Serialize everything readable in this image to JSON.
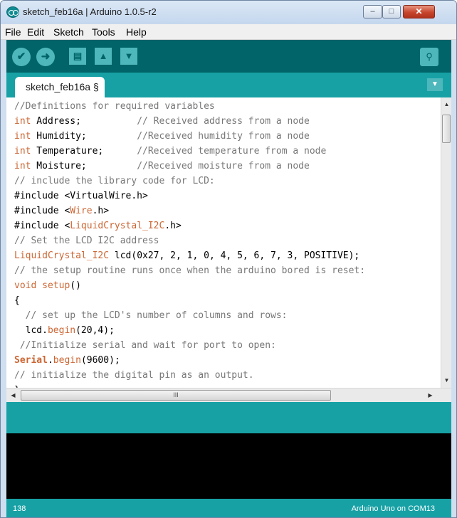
{
  "window": {
    "title": "sketch_feb16a | Arduino 1.0.5-r2",
    "app_icon": "arduino-logo-icon",
    "controls": {
      "minimize": "–",
      "maximize": "□",
      "close": "✕"
    }
  },
  "menu": [
    "File",
    "Edit",
    "Sketch",
    "Tools",
    "Help"
  ],
  "toolbar": {
    "buttons": [
      {
        "name": "verify",
        "icon": "checkmark-icon",
        "glyph": "✔"
      },
      {
        "name": "upload",
        "icon": "right-arrow-icon",
        "glyph": "➜"
      },
      {
        "name": "new",
        "icon": "new-file-icon",
        "glyph": "▤"
      },
      {
        "name": "open",
        "icon": "up-arrow-icon",
        "glyph": "▲"
      },
      {
        "name": "save",
        "icon": "down-arrow-icon",
        "glyph": "▼"
      }
    ],
    "serial_monitor": {
      "icon": "magnifier-icon",
      "glyph": "⚲"
    },
    "colors": {
      "bar": "#006468",
      "button": "#4db7bb"
    }
  },
  "tabs": {
    "active": "sketch_feb16a §",
    "menu_glyph": "▼"
  },
  "editor": {
    "lines": [
      [
        {
          "t": "//Definitions for required variables",
          "c": "cm"
        }
      ],
      [
        {
          "t": "int",
          "c": "kw"
        },
        {
          "t": " Address;          ",
          "c": ""
        },
        {
          "t": "// Received address from a node",
          "c": "cm"
        }
      ],
      [
        {
          "t": "int",
          "c": "kw"
        },
        {
          "t": " Humidity;         ",
          "c": ""
        },
        {
          "t": "//Received humidity from a node",
          "c": "cm"
        }
      ],
      [
        {
          "t": "int",
          "c": "kw"
        },
        {
          "t": " Temperature;      ",
          "c": ""
        },
        {
          "t": "//Received temperature from a node",
          "c": "cm"
        }
      ],
      [
        {
          "t": "int",
          "c": "kw"
        },
        {
          "t": " Moisture;         ",
          "c": ""
        },
        {
          "t": "//Received moisture from a node",
          "c": "cm"
        }
      ],
      [
        {
          "t": "// include the library code for LCD:",
          "c": "cm"
        }
      ],
      [
        {
          "t": "#include <VirtualWire.h>",
          "c": ""
        }
      ],
      [
        {
          "t": "#include <",
          "c": ""
        },
        {
          "t": "Wire",
          "c": "lib"
        },
        {
          "t": ".h>",
          "c": ""
        }
      ],
      [
        {
          "t": "#include <",
          "c": ""
        },
        {
          "t": "LiquidCrystal_I2C",
          "c": "lib"
        },
        {
          "t": ".h>",
          "c": ""
        }
      ],
      [
        {
          "t": "// Set the LCD I2C address",
          "c": "cm"
        }
      ],
      [
        {
          "t": "LiquidCrystal_I2C",
          "c": "lib"
        },
        {
          "t": " lcd(0x27, 2, 1, 0, 4, 5, 6, 7, 3, POSITIVE);",
          "c": ""
        }
      ],
      [
        {
          "t": "// the setup routine runs once when the arduino bored is reset:",
          "c": "cm"
        }
      ],
      [
        {
          "t": "void",
          "c": "kw"
        },
        {
          "t": " ",
          "c": ""
        },
        {
          "t": "setup",
          "c": "fn"
        },
        {
          "t": "()",
          "c": ""
        }
      ],
      [
        {
          "t": "{",
          "c": ""
        }
      ],
      [
        {
          "t": "  // set up the LCD's number of columns and rows:",
          "c": "cm"
        }
      ],
      [
        {
          "t": "  lcd.",
          "c": ""
        },
        {
          "t": "begin",
          "c": "fn"
        },
        {
          "t": "(20,4);",
          "c": ""
        }
      ],
      [
        {
          "t": " //Initialize serial and wait for port to open:",
          "c": "cm"
        }
      ],
      [
        {
          "t": "Serial",
          "c": "cls"
        },
        {
          "t": ".",
          "c": ""
        },
        {
          "t": "begin",
          "c": "fn"
        },
        {
          "t": "(9600);",
          "c": ""
        }
      ],
      [
        {
          "t": "// initialize the digital pin as an output.",
          "c": "cm"
        }
      ],
      [
        {
          "t": "}",
          "c": ""
        }
      ]
    ],
    "scroll": {
      "up": "▲",
      "down": "▼",
      "left": "◀",
      "right": "▶",
      "grip": "III",
      "vgrip": "≡"
    }
  },
  "status": {
    "line_number": "138",
    "board": "Arduino Uno on COM13"
  }
}
